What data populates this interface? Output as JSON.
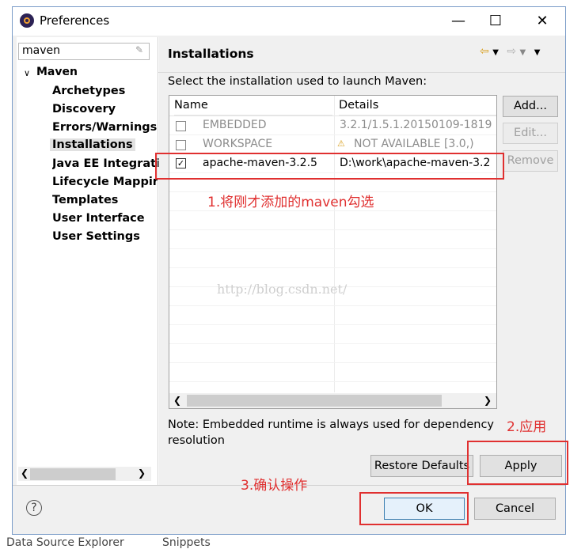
{
  "window": {
    "title": "Preferences",
    "minimize": "—",
    "maximize": "☐",
    "close": "✕"
  },
  "filter": {
    "value": "maven"
  },
  "tree": {
    "root": "Maven",
    "items": [
      {
        "label": "Archetypes"
      },
      {
        "label": "Discovery"
      },
      {
        "label": "Errors/Warnings"
      },
      {
        "label": "Installations",
        "selected": true
      },
      {
        "label": "Java EE Integrati"
      },
      {
        "label": "Lifecycle Mappir"
      },
      {
        "label": "Templates"
      },
      {
        "label": "User Interface"
      },
      {
        "label": "User Settings"
      }
    ]
  },
  "page": {
    "title": "Installations",
    "instruction": "Select the installation used to launch Maven:",
    "table": {
      "columns": [
        "Name",
        "Details"
      ],
      "rows": [
        {
          "name": "EMBEDDED",
          "details": "3.2.1/1.5.1.20150109-1819",
          "checked": false,
          "disabled": true
        },
        {
          "name": "WORKSPACE",
          "details": "NOT AVAILABLE [3.0,)",
          "checked": false,
          "disabled": true,
          "warning": true
        },
        {
          "name": "apache-maven-3.2.5",
          "details": "D:\\work\\apache-maven-3.2",
          "checked": true,
          "disabled": false
        }
      ]
    },
    "buttons": {
      "add": "Add...",
      "edit": "Edit...",
      "remove": "Remove"
    },
    "note": "Note: Embedded runtime is always used for dependency resolution",
    "restore_defaults": "Restore Defaults",
    "apply": "Apply"
  },
  "footer": {
    "help": "?",
    "ok": "OK",
    "cancel": "Cancel"
  },
  "annotations": {
    "step1": "1.将刚才添加的maven勾选",
    "step2": "2.应用",
    "step3": "3.确认操作",
    "watermark": "http://blog.csdn.net/"
  },
  "background_tabs": [
    "Data Source Explorer",
    "Snippets"
  ],
  "colors": {
    "annotation_red": "#e03030",
    "ok_border": "#3c7fb1"
  }
}
